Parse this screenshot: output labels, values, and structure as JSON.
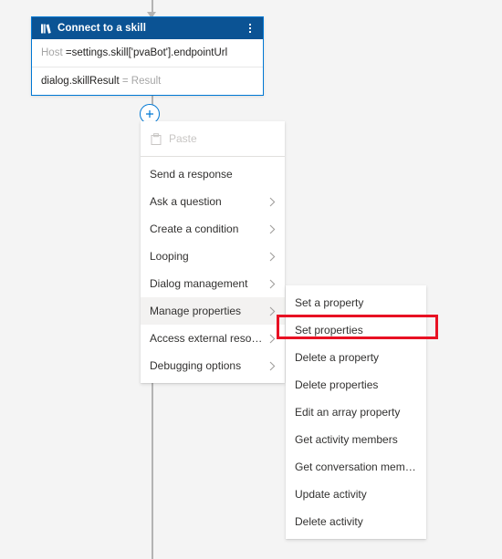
{
  "canvas": {
    "background_color": "#f4f4f4",
    "connector_color": "#b3b3b3",
    "accent_color": "#0078d4",
    "add_node_icon": "plus-icon",
    "arrow_icon": "arrow-down-icon"
  },
  "node": {
    "title": "Connect to a skill",
    "header_icon": "skill-book-icon",
    "header_color": "#0b5394",
    "border_color": "#0078d4",
    "menu_icon": "more-vertical-icon",
    "rows": [
      {
        "label": "Host",
        "value": "=settings.skill['pvaBot'].endpointUrl"
      },
      {
        "label": "dialog.skillResult",
        "value": "= Result"
      }
    ]
  },
  "context_menu": {
    "items": [
      {
        "label": "Paste",
        "icon": "clipboard-paste-icon",
        "disabled": true,
        "has_submenu": false
      },
      {
        "label": "Send a response",
        "disabled": false,
        "has_submenu": false
      },
      {
        "label": "Ask a question",
        "disabled": false,
        "has_submenu": true
      },
      {
        "label": "Create a condition",
        "disabled": false,
        "has_submenu": true
      },
      {
        "label": "Looping",
        "disabled": false,
        "has_submenu": true
      },
      {
        "label": "Dialog management",
        "disabled": false,
        "has_submenu": true
      },
      {
        "label": "Manage properties",
        "disabled": false,
        "has_submenu": true,
        "highlighted": true
      },
      {
        "label": "Access external resources",
        "disabled": false,
        "has_submenu": true
      },
      {
        "label": "Debugging options",
        "disabled": false,
        "has_submenu": true
      }
    ]
  },
  "submenu": {
    "parent": "Manage properties",
    "items": [
      {
        "label": "Set a property"
      },
      {
        "label": "Set properties",
        "annotated": true
      },
      {
        "label": "Delete a property"
      },
      {
        "label": "Delete properties"
      },
      {
        "label": "Edit an array property"
      },
      {
        "label": "Get activity members"
      },
      {
        "label": "Get conversation members"
      },
      {
        "label": "Update activity"
      },
      {
        "label": "Delete activity"
      }
    ]
  },
  "annotation": {
    "target": "Set properties",
    "color": "#e81123"
  }
}
